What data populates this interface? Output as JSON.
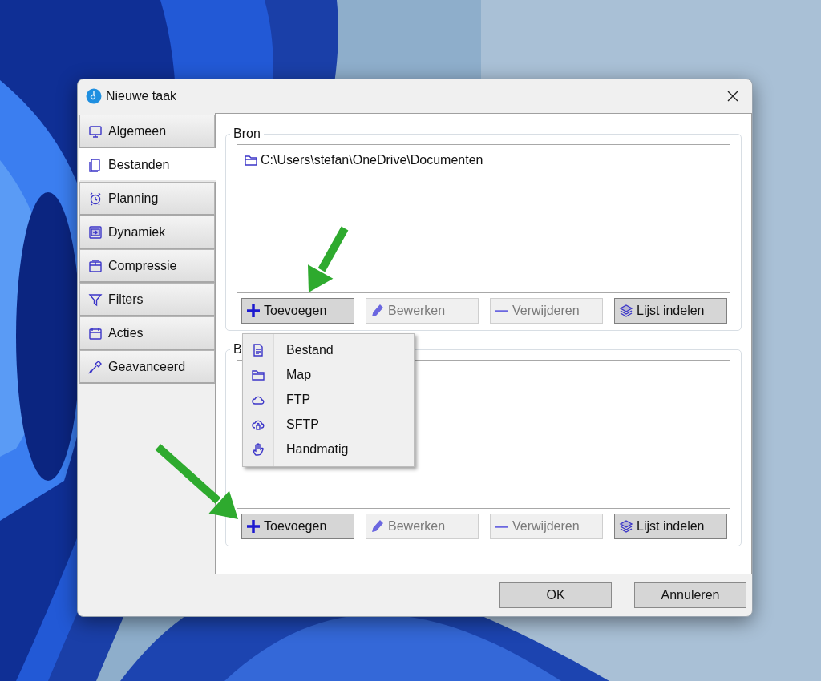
{
  "window": {
    "title": "Nieuwe taak"
  },
  "tabs": [
    {
      "label": "Algemeen",
      "selected": false
    },
    {
      "label": "Bestanden",
      "selected": true
    },
    {
      "label": "Planning",
      "selected": false
    },
    {
      "label": "Dynamiek",
      "selected": false
    },
    {
      "label": "Compressie",
      "selected": false
    },
    {
      "label": "Filters",
      "selected": false
    },
    {
      "label": "Acties",
      "selected": false
    },
    {
      "label": "Geavanceerd",
      "selected": false
    }
  ],
  "groups": [
    {
      "label": "Bron",
      "items": [
        {
          "text": "C:\\Users\\stefan\\OneDrive\\Documenten"
        }
      ],
      "buttons": [
        {
          "label": "Toevoegen",
          "disabled": false
        },
        {
          "label": "Bewerken",
          "disabled": true
        },
        {
          "label": "Verwijderen",
          "disabled": true
        },
        {
          "label": "Lijst indelen",
          "disabled": false
        }
      ]
    },
    {
      "label": "B",
      "buttons": [
        {
          "label": "Toevoegen",
          "disabled": false
        },
        {
          "label": "Bewerken",
          "disabled": true
        },
        {
          "label": "Verwijderen",
          "disabled": true
        },
        {
          "label": "Lijst indelen",
          "disabled": false
        }
      ]
    }
  ],
  "menu": {
    "items": [
      {
        "label": "Bestand"
      },
      {
        "label": "Map"
      },
      {
        "label": "FTP"
      },
      {
        "label": "SFTP"
      },
      {
        "label": "Handmatig"
      }
    ]
  },
  "footer_buttons": [
    "OK",
    "Annuleren"
  ]
}
